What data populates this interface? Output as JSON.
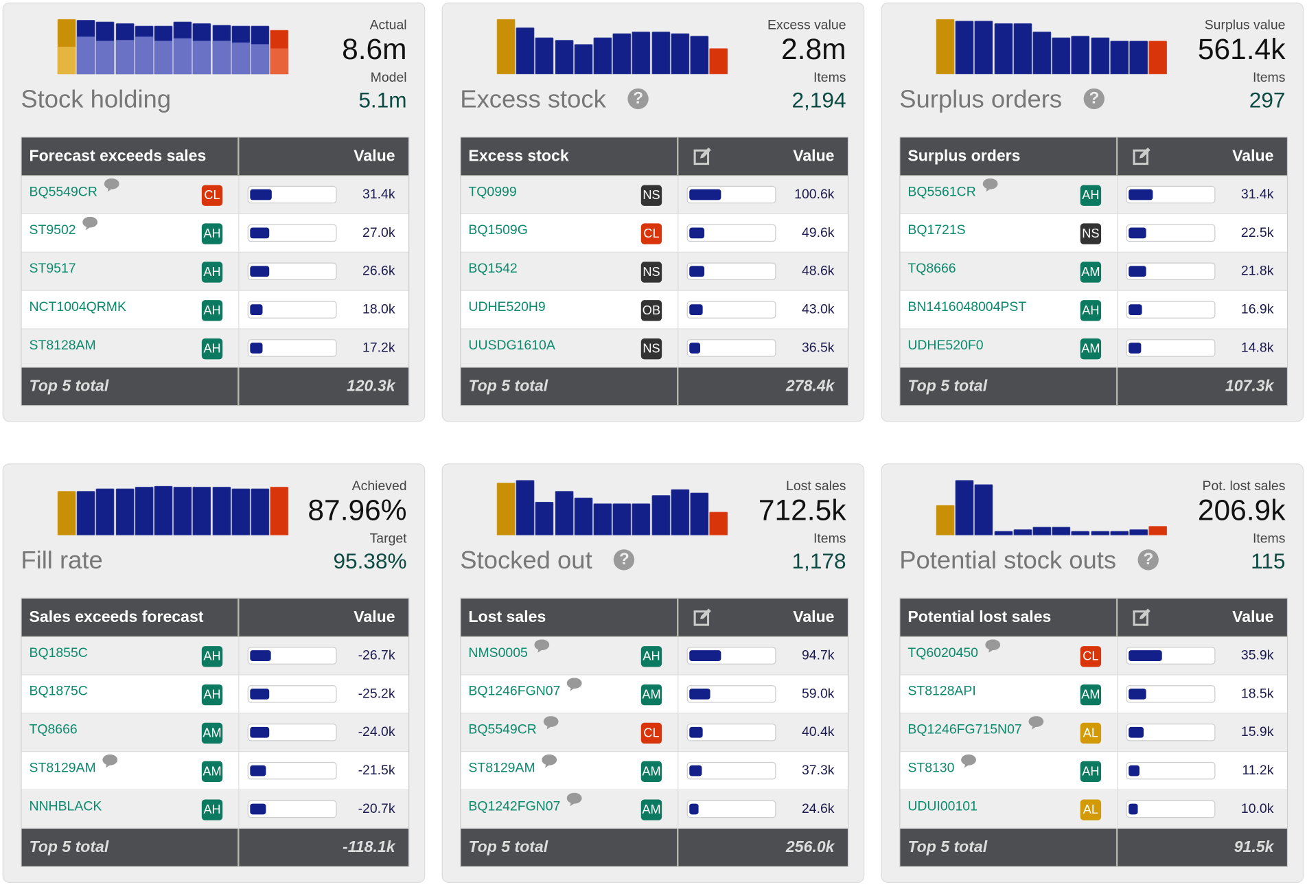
{
  "colors": {
    "first_bar": "#c98f06",
    "first_bar_light": "#e5b63f",
    "mid_bar": "#13208a",
    "mid_bar_light": "#6a72c6",
    "last_bar": "#d9350a",
    "last_bar_light": "#e8623a",
    "fill": "#13208a",
    "badges": {
      "CL": "#d9350a",
      "AH": "#0b7a60",
      "AM": "#0b7a60",
      "NS": "#333333",
      "OB": "#333333",
      "AL": "#d29a06"
    }
  },
  "panels": [
    {
      "title": "Stock holding",
      "help": false,
      "kpi_label1": "Actual",
      "kpi_value1": "8.6m",
      "kpi_label2": "Model",
      "kpi_value2": "5.1m",
      "spark": {
        "stacked": true,
        "values": [
          100,
          98,
          95,
          93,
          88,
          88,
          95,
          93,
          90,
          88,
          88,
          80
        ],
        "lower_values": [
          50,
          68,
          60,
          62,
          68,
          60,
          65,
          60,
          60,
          58,
          55,
          47
        ]
      },
      "table": {
        "header": "Forecast exceeds sales",
        "value_header": "Value",
        "edit_icon": false,
        "footer_label": "Top 5 total",
        "footer_value": "120.3k",
        "rows": [
          {
            "name": "BQ5549CR",
            "comment": true,
            "badge": "CL",
            "fill_pct": 25,
            "value": "31.4k"
          },
          {
            "name": "ST9502",
            "comment": true,
            "badge": "AH",
            "fill_pct": 22,
            "value": "27.0k"
          },
          {
            "name": "ST9517",
            "comment": false,
            "badge": "AH",
            "fill_pct": 22,
            "value": "26.6k"
          },
          {
            "name": "NCT1004QRMK",
            "comment": false,
            "badge": "AH",
            "fill_pct": 14,
            "value": "18.0k"
          },
          {
            "name": "ST8128AM",
            "comment": false,
            "badge": "AH",
            "fill_pct": 14,
            "value": "17.2k"
          }
        ]
      }
    },
    {
      "title": "Excess stock",
      "help": true,
      "kpi_label1": "Excess value",
      "kpi_value1": "2.8m",
      "kpi_label2": "Items",
      "kpi_value2": "2,194",
      "spark": {
        "stacked": false,
        "values": [
          100,
          85,
          67,
          62,
          55,
          67,
          75,
          77,
          77,
          75,
          70,
          47
        ]
      },
      "table": {
        "header": "Excess stock",
        "value_header": "Value",
        "edit_icon": true,
        "footer_label": "Top 5 total",
        "footer_value": "278.4k",
        "rows": [
          {
            "name": "TQ0999",
            "comment": false,
            "badge": "NS",
            "fill_pct": 36,
            "value": "100.6k"
          },
          {
            "name": "BQ1509G",
            "comment": false,
            "badge": "CL",
            "fill_pct": 17,
            "value": "49.6k"
          },
          {
            "name": "BQ1542",
            "comment": false,
            "badge": "NS",
            "fill_pct": 17,
            "value": "48.6k"
          },
          {
            "name": "UDHE520H9",
            "comment": false,
            "badge": "OB",
            "fill_pct": 15,
            "value": "43.0k"
          },
          {
            "name": "UUSDG1610A",
            "comment": false,
            "badge": "NS",
            "fill_pct": 12,
            "value": "36.5k"
          }
        ]
      }
    },
    {
      "title": "Surplus orders",
      "help": true,
      "kpi_label1": "Surplus value",
      "kpi_value1": "561.4k",
      "kpi_label2": "Items",
      "kpi_value2": "297",
      "spark": {
        "stacked": false,
        "values": [
          100,
          97,
          97,
          92,
          92,
          77,
          67,
          70,
          67,
          60,
          60,
          60
        ]
      },
      "table": {
        "header": "Surplus orders",
        "value_header": "Value",
        "edit_icon": true,
        "footer_label": "Top 5 total",
        "footer_value": "107.3k",
        "rows": [
          {
            "name": "BQ5561CR",
            "comment": true,
            "badge": "AH",
            "fill_pct": 28,
            "value": "31.4k"
          },
          {
            "name": "BQ1721S",
            "comment": false,
            "badge": "NS",
            "fill_pct": 20,
            "value": "22.5k"
          },
          {
            "name": "TQ8666",
            "comment": false,
            "badge": "AM",
            "fill_pct": 20,
            "value": "21.8k"
          },
          {
            "name": "BN1416048004PST",
            "comment": false,
            "badge": "AH",
            "fill_pct": 15,
            "value": "16.9k"
          },
          {
            "name": "UDHE520F0",
            "comment": false,
            "badge": "AM",
            "fill_pct": 14,
            "value": "14.8k"
          }
        ]
      }
    },
    {
      "title": "Fill rate",
      "help": false,
      "kpi_label1": "Achieved",
      "kpi_value1": "87.96%",
      "kpi_label2": "Target",
      "kpi_value2": "95.38%",
      "spark": {
        "stacked": false,
        "values": [
          80,
          80,
          85,
          85,
          88,
          90,
          88,
          88,
          88,
          85,
          85,
          88
        ]
      },
      "table": {
        "header": "Sales exceeds forecast",
        "value_header": "Value",
        "edit_icon": false,
        "footer_label": "Top 5 total",
        "footer_value": "-118.1k",
        "rows": [
          {
            "name": "BQ1855C",
            "comment": false,
            "badge": "AH",
            "fill_pct": 24,
            "value": "-26.7k"
          },
          {
            "name": "BQ1875C",
            "comment": false,
            "badge": "AH",
            "fill_pct": 22,
            "value": "-25.2k"
          },
          {
            "name": "TQ8666",
            "comment": false,
            "badge": "AM",
            "fill_pct": 22,
            "value": "-24.0k"
          },
          {
            "name": "ST8129AM",
            "comment": true,
            "badge": "AM",
            "fill_pct": 18,
            "value": "-21.5k"
          },
          {
            "name": "NNHBLACK",
            "comment": false,
            "badge": "AH",
            "fill_pct": 18,
            "value": "-20.7k"
          }
        ]
      }
    },
    {
      "title": "Stocked out",
      "help": true,
      "kpi_label1": "Lost sales",
      "kpi_value1": "712.5k",
      "kpi_label2": "Items",
      "kpi_value2": "1,178",
      "spark": {
        "stacked": false,
        "values": [
          95,
          100,
          61,
          81,
          68,
          58,
          58,
          58,
          73,
          83,
          78,
          43
        ]
      },
      "table": {
        "header": "Lost sales",
        "value_header": "Value",
        "edit_icon": true,
        "footer_label": "Top 5 total",
        "footer_value": "256.0k",
        "rows": [
          {
            "name": "NMS0005",
            "comment": true,
            "badge": "AH",
            "fill_pct": 36,
            "value": "94.7k"
          },
          {
            "name": "BQ1246FGN07",
            "comment": true,
            "badge": "AM",
            "fill_pct": 24,
            "value": "59.0k"
          },
          {
            "name": "BQ5549CR",
            "comment": true,
            "badge": "CL",
            "fill_pct": 15,
            "value": "40.4k"
          },
          {
            "name": "ST8129AM",
            "comment": true,
            "badge": "AM",
            "fill_pct": 14,
            "value": "37.3k"
          },
          {
            "name": "BQ1242FGN07",
            "comment": true,
            "badge": "AM",
            "fill_pct": 10,
            "value": "24.6k"
          }
        ]
      }
    },
    {
      "title": "Potential stock outs",
      "help": true,
      "kpi_label1": "Pot. lost sales",
      "kpi_value1": "206.9k",
      "kpi_label2": "Items",
      "kpi_value2": "115",
      "spark": {
        "stacked": false,
        "values": [
          55,
          100,
          92,
          7,
          10,
          15,
          15,
          7,
          7,
          7,
          10,
          17
        ]
      },
      "table": {
        "header": "Potential lost sales",
        "value_header": "Value",
        "edit_icon": true,
        "footer_label": "Top 5 total",
        "footer_value": "91.5k",
        "rows": [
          {
            "name": "TQ6020450",
            "comment": true,
            "badge": "CL",
            "fill_pct": 38,
            "value": "35.9k"
          },
          {
            "name": "ST8128API",
            "comment": false,
            "badge": "AM",
            "fill_pct": 20,
            "value": "18.5k"
          },
          {
            "name": "BQ1246FG715N07",
            "comment": true,
            "badge": "AL",
            "fill_pct": 17,
            "value": "15.9k"
          },
          {
            "name": "ST8130",
            "comment": true,
            "badge": "AH",
            "fill_pct": 12,
            "value": "11.2k"
          },
          {
            "name": "UDUI00101",
            "comment": false,
            "badge": "AL",
            "fill_pct": 10,
            "value": "10.0k"
          }
        ]
      }
    }
  ]
}
